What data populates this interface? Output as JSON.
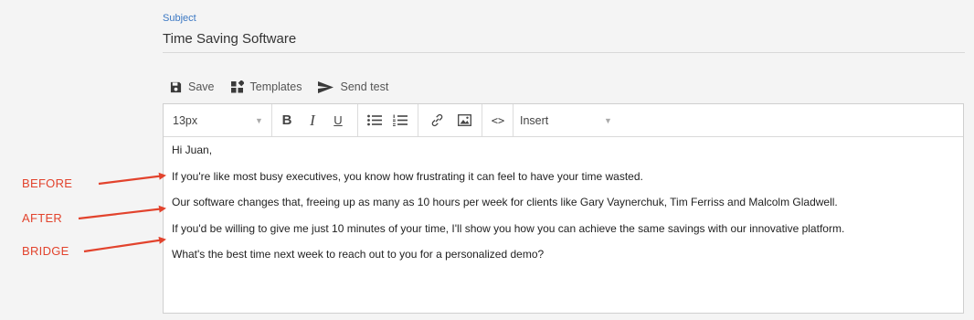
{
  "subject": {
    "label": "Subject",
    "value": "Time Saving Software"
  },
  "actions": {
    "save": "Save",
    "templates": "Templates",
    "send_test": "Send test"
  },
  "toolbar": {
    "font_size": "13px",
    "insert": "Insert",
    "bold": "B",
    "italic": "I",
    "underline": "U",
    "code": "<>"
  },
  "email_body": [
    "Hi Juan,",
    "If you're like most busy executives, you know how frustrating it can feel to have your time wasted.",
    "Our software changes that, freeing up as many as 10 hours per week for clients like Gary Vaynerchuk, Tim Ferriss and Malcolm Gladwell.",
    "If you'd be willing to give me just 10 minutes of your time, I'll show you how you can achieve the same savings with our innovative platform.",
    "What's the best time next week to reach out to you for a personalized demo?"
  ],
  "annotations": {
    "before": "BEFORE",
    "after": "AFTER",
    "bridge": "BRIDGE",
    "accent_color": "#e2432d"
  }
}
